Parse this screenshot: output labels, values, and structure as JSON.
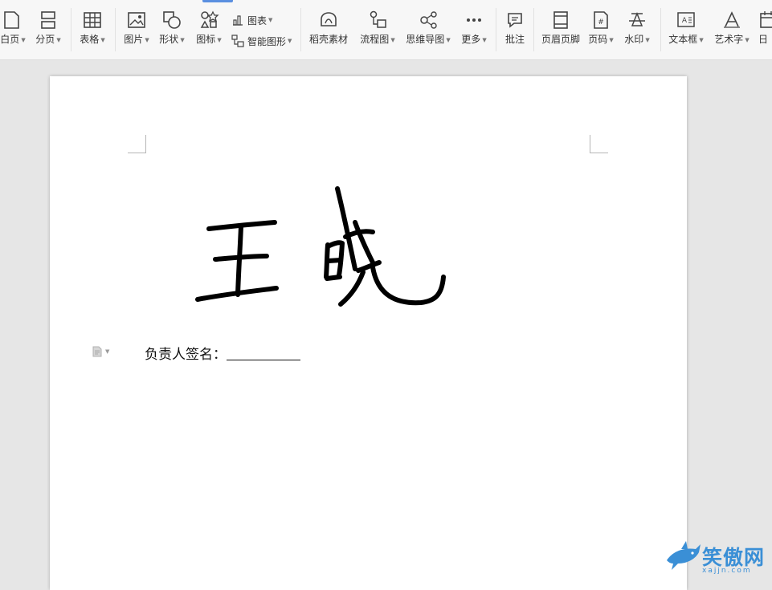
{
  "ribbon": {
    "tools": {
      "blank_page": "白页",
      "page_break": "分页",
      "table": "表格",
      "picture": "图片",
      "shape": "形状",
      "icon_lib": "图标",
      "chart": "图表",
      "smart_art": "智能图形",
      "docer": "稻壳素材",
      "flowchart": "流程图",
      "mindmap": "思维导图",
      "more": "更多",
      "comment": "批注",
      "header_footer": "页眉页脚",
      "page_number": "页码",
      "watermark": "水印",
      "textbox": "文本框",
      "wordart": "艺术字",
      "date": "日"
    }
  },
  "document": {
    "signature_label": "负责人签名："
  },
  "site_watermark": {
    "text": "笑傲网",
    "url": "xajjn.com"
  },
  "colors": {
    "accent": "#5a8fe0",
    "watermark": "#3a8fd6"
  }
}
